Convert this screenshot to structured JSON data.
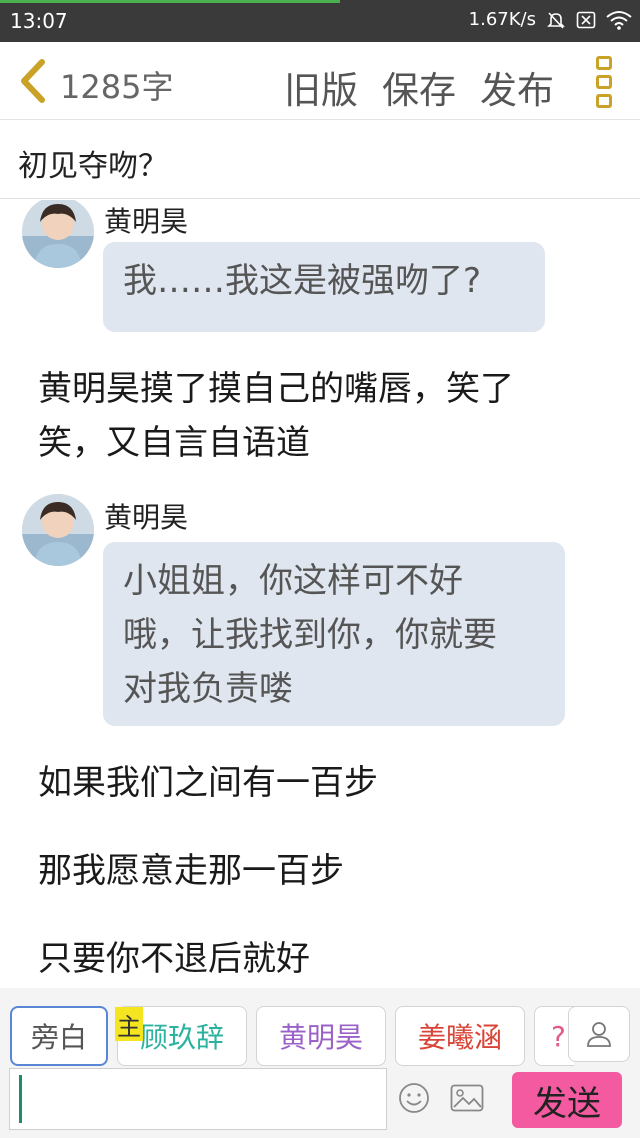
{
  "status_bar": {
    "time": "13:07",
    "net_speed": "1.67K/s",
    "icons": [
      "mute-bell-icon",
      "close-box-icon",
      "wifi-icon"
    ]
  },
  "toolbar": {
    "word_count": "1285字",
    "old_version_label": "旧版",
    "save_label": "保存",
    "publish_label": "发布",
    "icons": [
      "back-chevron-icon",
      "more-menu-icon"
    ]
  },
  "story": {
    "title": "初见夺吻？",
    "blocks": [
      {
        "type": "dialogue",
        "speaker": "黄明昊",
        "text": "我……我这是被强吻了?"
      },
      {
        "type": "narration",
        "lines": [
          "黄明昊摸了摸自己的嘴唇，笑了",
          "笑，又自言自语道"
        ]
      },
      {
        "type": "dialogue",
        "speaker": "黄明昊",
        "lines": [
          "小姐姐，你这样可不好",
          "哦，让我找到你，你就要",
          "对我负责喽"
        ]
      },
      {
        "type": "narration",
        "text": "如果我们之间有一百步"
      },
      {
        "type": "narration",
        "text": "那我愿意走那一百步"
      },
      {
        "type": "narration",
        "text": "只要你不退后就好"
      }
    ]
  },
  "roles": {
    "narrator_label": "旁白",
    "main_tag": "主",
    "items": [
      {
        "name": "顾玖辞",
        "color": "#2bb3a0"
      },
      {
        "name": "黄明昊",
        "color": "#9a62c8"
      },
      {
        "name": "姜曦涵",
        "color": "#d94437"
      },
      {
        "name": "?",
        "color": "#e05a8c"
      }
    ]
  },
  "composer": {
    "input_value": "",
    "send_label": "发送",
    "icons": [
      "emoji-icon",
      "image-icon",
      "person-icon"
    ]
  },
  "colors": {
    "accent_pink": "#f45aa0",
    "bubble_bg": "#dfe6ef",
    "menu_gold": "#c9a227",
    "main_tag_yellow": "#f5e520"
  }
}
